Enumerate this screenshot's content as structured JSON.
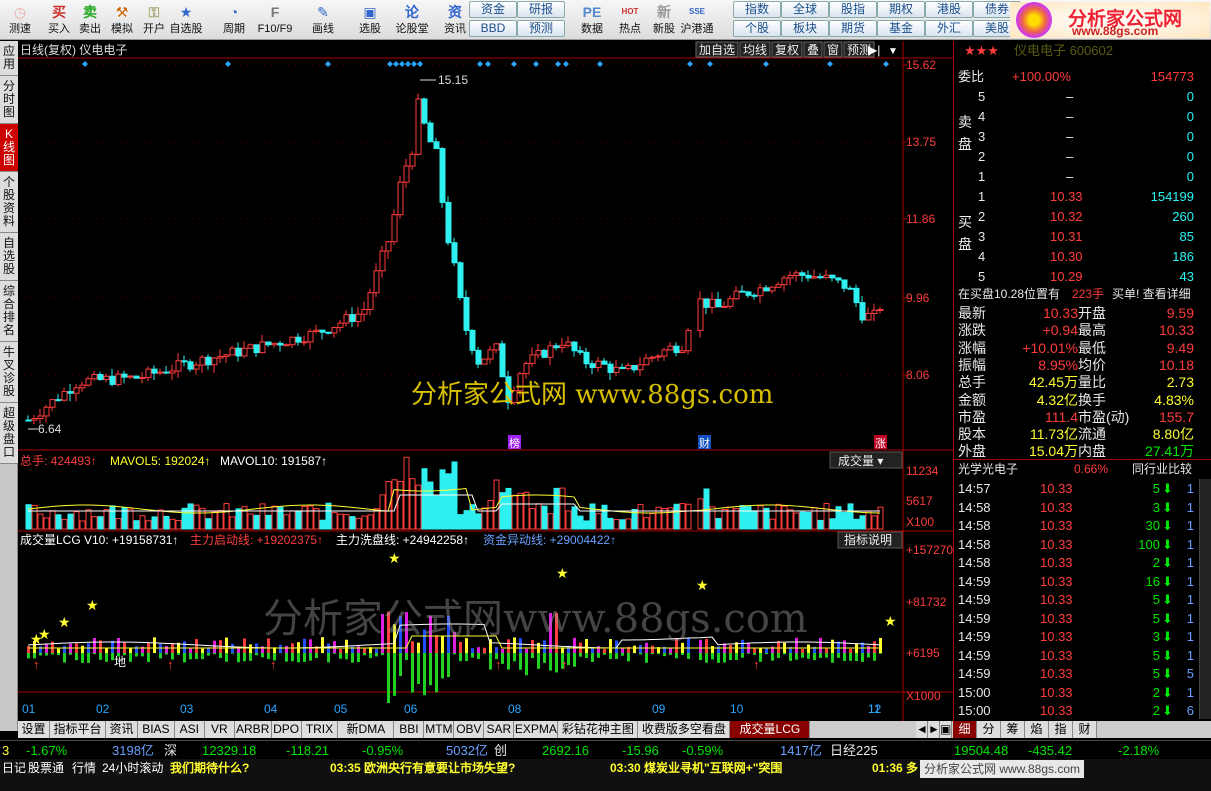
{
  "toolbar": {
    "items": [
      {
        "label": "测速",
        "icon": "clock-icon"
      },
      {
        "label": "买入",
        "icon": "buy-icon"
      },
      {
        "label": "卖出",
        "icon": "sell-icon"
      },
      {
        "label": "模拟",
        "icon": "gavel-icon"
      },
      {
        "label": "开户",
        "icon": "lock-icon"
      },
      {
        "label": "自选股",
        "icon": "star-icon"
      },
      {
        "label": "周期",
        "icon": "period-icon"
      },
      {
        "label": "F10/F9",
        "icon": "f10-icon"
      },
      {
        "label": "画线",
        "icon": "pen-icon"
      },
      {
        "label": "选股",
        "icon": "screen-icon"
      },
      {
        "label": "论股堂",
        "icon": "forum-icon"
      },
      {
        "label": "资讯",
        "icon": "news-icon"
      },
      {
        "label": "数据",
        "icon": "pe-icon"
      },
      {
        "label": "热点",
        "icon": "hot-icon"
      },
      {
        "label": "新股",
        "icon": "new-icon"
      },
      {
        "label": "沪港通",
        "icon": "sse-hke-icon"
      }
    ],
    "grid_buttons": [
      "资金",
      "研报",
      "BBD",
      "预测",
      "指数",
      "全球",
      "股指",
      "期权",
      "港股",
      "债券",
      "个股",
      "板块",
      "期货",
      "基金",
      "外汇",
      "美股"
    ],
    "logo_text": "分析家公式网",
    "logo_url": "www.88gs.com"
  },
  "left_tabs": [
    "应用",
    "分时图",
    "K线图",
    "个股资料",
    "自选股",
    "综合排名",
    "牛叉诊股",
    "超级盘口"
  ],
  "chart": {
    "title": "日线(复权) 仪电电子",
    "top_buttons": [
      "加自选",
      "均线",
      "复权",
      "叠",
      "窗",
      "预测"
    ],
    "price_axis": [
      "15.62",
      "13.75",
      "11.86",
      "9.96",
      "8.06"
    ],
    "high_label": "15.15",
    "low_label": "6.64",
    "markers": [
      "榜",
      "财",
      "涨"
    ],
    "vol_header": {
      "a": "总手: 424493",
      "b": "MAVOL5: 192024",
      "c": "MAVOL10: 191587"
    },
    "vol_dropdown": "成交量",
    "vol_axis": [
      "11234",
      "5617",
      "X100"
    ],
    "lcg_header": {
      "name": "成交量LCG V10: +19158731",
      "a": "主力启动线: +19202375",
      "b": "主力洗盘线: +24942258",
      "c": "资金异动线: +29004422"
    },
    "lcg_button": "指标说明",
    "lcg_axis": [
      "+157270",
      "+81732",
      "+6195",
      "X1000"
    ],
    "lcg_text": "地",
    "months": [
      "01",
      "02",
      "03",
      "04",
      "05",
      "06",
      "08",
      "09",
      "10",
      "11",
      "12"
    ],
    "watermark1": "分析家公式网 www.88gs.com",
    "watermark2": "分析家公式网www.88gs.com"
  },
  "bottom_tabs": [
    "设置",
    "指标平台",
    "资讯",
    "BIAS",
    "ASI",
    "VR",
    "ARBR",
    "DPO",
    "TRIX",
    "新DMA",
    "BBI",
    "MTM",
    "OBV",
    "SAR",
    "EXPMA",
    "彩钻花神主图",
    "收费版多空看盘",
    "成交量LCG"
  ],
  "right_panel": {
    "stars": "★★★",
    "stock_title": "仪电电子 600602",
    "weibi": {
      "label": "委比",
      "pct": "+100.00%",
      "val": "154773"
    },
    "sell": [
      {
        "n": "5",
        "p": "–",
        "v": "0"
      },
      {
        "n": "4",
        "p": "–",
        "v": "0"
      },
      {
        "n": "3",
        "p": "–",
        "v": "0"
      },
      {
        "n": "2",
        "p": "–",
        "v": "0"
      },
      {
        "n": "1",
        "p": "–",
        "v": "0"
      }
    ],
    "buy": [
      {
        "n": "1",
        "p": "10.33",
        "v": "154199"
      },
      {
        "n": "2",
        "p": "10.32",
        "v": "260"
      },
      {
        "n": "3",
        "p": "10.31",
        "v": "85"
      },
      {
        "n": "4",
        "p": "10.30",
        "v": "186"
      },
      {
        "n": "5",
        "p": "10.29",
        "v": "43"
      }
    ],
    "sell_label": "卖盘",
    "buy_label": "买盘",
    "info_line": {
      "a": "在买盘10.28位置有",
      "b": "223手",
      "c": "买单! 查看详细"
    },
    "quotes": [
      [
        "最新",
        "10.33",
        "开盘",
        "9.59"
      ],
      [
        "涨跌",
        "+0.94",
        "最高",
        "10.33"
      ],
      [
        "涨幅",
        "+10.01%",
        "最低",
        "9.49"
      ],
      [
        "振幅",
        "8.95%",
        "均价",
        "10.18"
      ],
      [
        "总手",
        "42.45万",
        "量比",
        "2.73"
      ],
      [
        "金额",
        "4.32亿",
        "换手",
        "4.83%"
      ],
      [
        "市盈",
        "111.4",
        "市盈(动)",
        "155.7"
      ],
      [
        "股本",
        "11.73亿",
        "流通",
        "8.80亿"
      ],
      [
        "外盘",
        "15.04万",
        "内盘",
        "27.41万"
      ]
    ],
    "sector": {
      "name": "光学光电子",
      "pct": "0.66%",
      "btn": "同行业比较"
    },
    "ticks": [
      [
        "14:57",
        "10.33",
        "5",
        "1"
      ],
      [
        "14:58",
        "10.33",
        "3",
        "1"
      ],
      [
        "14:58",
        "10.33",
        "30",
        "1"
      ],
      [
        "14:58",
        "10.33",
        "100",
        "1"
      ],
      [
        "14:58",
        "10.33",
        "2",
        "1"
      ],
      [
        "14:59",
        "10.33",
        "16",
        "1"
      ],
      [
        "14:59",
        "10.33",
        "5",
        "1"
      ],
      [
        "14:59",
        "10.33",
        "5",
        "1"
      ],
      [
        "14:59",
        "10.33",
        "3",
        "1"
      ],
      [
        "14:59",
        "10.33",
        "5",
        "1"
      ],
      [
        "14:59",
        "10.33",
        "5",
        "5"
      ],
      [
        "15:00",
        "10.33",
        "2",
        "1"
      ],
      [
        "15:00",
        "10.33",
        "2",
        "6"
      ]
    ],
    "tabs": [
      "细",
      "分",
      "筹",
      "焰",
      "指",
      "财"
    ]
  },
  "status1": [
    {
      "t": "3",
      "c": "yel"
    },
    {
      "t": "-1.67%",
      "c": "grn"
    },
    {
      "t": "3198亿",
      "c": "blu"
    },
    {
      "t": "深",
      "c": "wht"
    },
    {
      "t": "12329.18",
      "c": "grn"
    },
    {
      "t": "-118.21",
      "c": "grn"
    },
    {
      "t": "-0.95%",
      "c": "grn"
    },
    {
      "t": "5032亿",
      "c": "blu"
    },
    {
      "t": "创",
      "c": "wht"
    },
    {
      "t": "2692.16",
      "c": "grn"
    },
    {
      "t": "-15.96",
      "c": "grn"
    },
    {
      "t": "-0.59%",
      "c": "grn"
    },
    {
      "t": "1417亿",
      "c": "blu"
    },
    {
      "t": "日经225",
      "c": "wht"
    },
    {
      "t": "19504.48",
      "c": "grn"
    },
    {
      "t": "-435.42",
      "c": "grn"
    },
    {
      "t": "-2.18%",
      "c": "grn"
    }
  ],
  "status2": [
    {
      "t": "日记"
    },
    {
      "t": "股票通"
    },
    {
      "t": "行情"
    },
    {
      "t": "24小时滚动"
    },
    {
      "t": "我们期待什么?"
    },
    {
      "t": "03:35 欧洲央行有意要让市场失望?"
    },
    {
      "t": "03:30 煤炭业寻机\"互联网+\"突围"
    },
    {
      "t": "01:36 多"
    }
  ],
  "status_watermark": "分析家公式网 www.88gs.com"
}
